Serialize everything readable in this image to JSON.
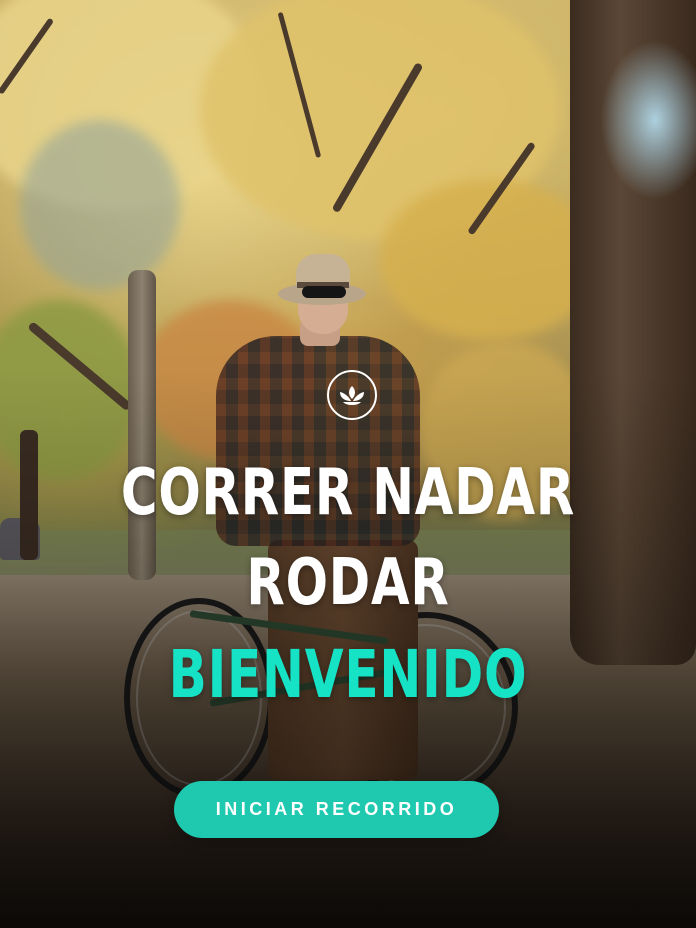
{
  "hero": {
    "headline_line1": "CORRER NADAR",
    "headline_line2": "RODAR",
    "welcome": "BIENVENIDO",
    "cta_label": "INICIAR RECORRIDO",
    "logo_icon": "lotus-icon"
  },
  "colors": {
    "accent": "#1ec9b0",
    "welcome_text": "#16e3c6",
    "headline_text": "#ffffff"
  }
}
